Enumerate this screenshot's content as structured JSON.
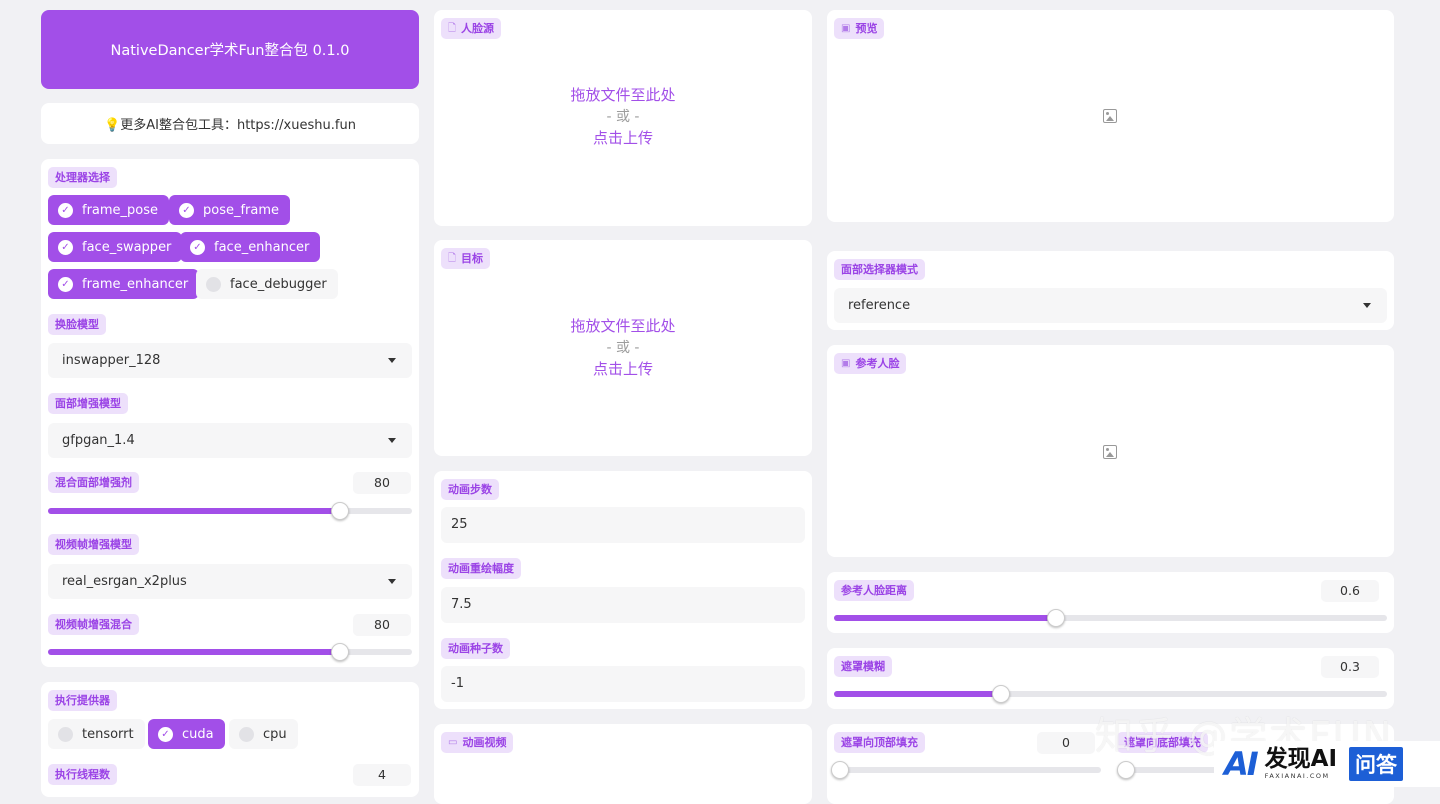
{
  "app_title": "NativeDancer学术Fun整合包 0.1.0",
  "info_text": "💡更多AI整合包工具：https://xueshu.fun",
  "processors": {
    "label": "处理器选择",
    "items": [
      {
        "label": "frame_pose",
        "checked": true
      },
      {
        "label": "pose_frame",
        "checked": true
      },
      {
        "label": "face_swapper",
        "checked": true
      },
      {
        "label": "face_enhancer",
        "checked": true
      },
      {
        "label": "frame_enhancer",
        "checked": true
      },
      {
        "label": "face_debugger",
        "checked": false
      }
    ]
  },
  "face_swapper_model": {
    "label": "换脸模型",
    "value": "inswapper_128"
  },
  "face_enhancer_model": {
    "label": "面部增强模型",
    "value": "gfpgan_1.4"
  },
  "face_enhancer_blend": {
    "label": "混合面部增强剂",
    "value": "80",
    "fraction": 0.8
  },
  "frame_enhancer_model": {
    "label": "视频帧增强模型",
    "value": "real_esrgan_x2plus"
  },
  "frame_enhancer_blend": {
    "label": "视频帧增强混合",
    "value": "80",
    "fraction": 0.8
  },
  "execution_providers": {
    "label": "执行提供器",
    "items": [
      {
        "label": "tensorrt",
        "checked": false
      },
      {
        "label": "cuda",
        "checked": true
      },
      {
        "label": "cpu",
        "checked": false
      }
    ]
  },
  "execution_threads": {
    "label": "执行线程数",
    "value": "4"
  },
  "source": {
    "label": "人脸源",
    "drop_text": "拖放文件至此处",
    "or_text": "- 或 -",
    "click_text": "点击上传"
  },
  "target": {
    "label": "目标",
    "drop_text": "拖放文件至此处",
    "or_text": "- 或 -",
    "click_text": "点击上传"
  },
  "anim_steps": {
    "label": "动画步数",
    "value": "25"
  },
  "anim_repaint": {
    "label": "动画重绘幅度",
    "value": "7.5"
  },
  "anim_seed": {
    "label": "动画种子数",
    "value": "-1"
  },
  "anim_video": {
    "label": "动画视频"
  },
  "preview": {
    "label": "预览"
  },
  "face_selector_mode": {
    "label": "面部选择器模式",
    "value": "reference"
  },
  "reference_face": {
    "label": "参考人脸"
  },
  "reference_face_distance": {
    "label": "参考人脸距离",
    "value": "0.6",
    "fraction": 0.4
  },
  "mask_blur": {
    "label": "遮罩模糊",
    "value": "0.3",
    "fraction": 0.3
  },
  "mask_padding_top": {
    "label": "遮罩向顶部填充",
    "value": "0",
    "fraction": 0
  },
  "mask_padding_bottom": {
    "label": "遮罩向底部填充",
    "value": "",
    "fraction": 0
  },
  "watermarks": {
    "zhihu": "知乎 @学术FUN",
    "brand": "发现AI",
    "brand_sub": "FAXIANAI.COM",
    "qa": "问答",
    "ai_logo": "AI"
  },
  "colors": {
    "accent": "#a24fe8",
    "tag_bg": "#ede0fb",
    "tag_text": "#9b44e6"
  }
}
